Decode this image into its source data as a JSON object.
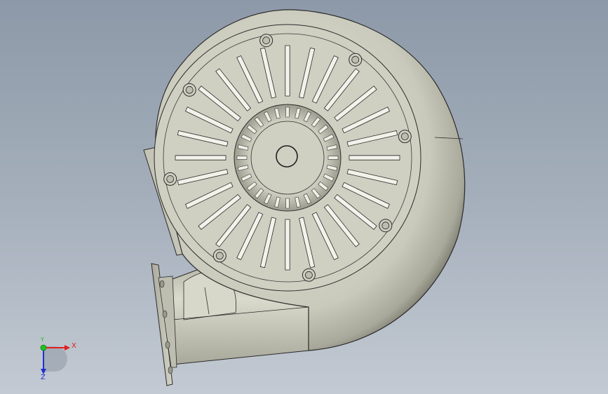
{
  "viewport": {
    "background_top": "#8d99a8",
    "background_bottom": "#c3cad3"
  },
  "model": {
    "part": "centrifugal-blower",
    "body_color": "#cfcfc2",
    "edge_color": "#2b2b2b",
    "slot_count": 28,
    "bolt_hole_count": 8
  },
  "triad": {
    "x_label": "X",
    "y_label": "Y",
    "z_label": "Z",
    "x_color": "#e02020",
    "y_color": "#20c020",
    "z_color": "#2030d0"
  }
}
